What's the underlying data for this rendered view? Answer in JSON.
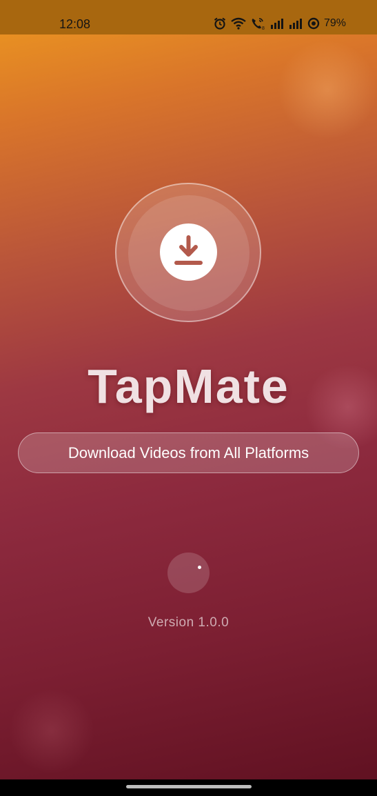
{
  "status_bar": {
    "time": "12:08",
    "battery": "79%",
    "icons": [
      "alarm-icon",
      "wifi-icon",
      "volte-call-icon",
      "signal-icon",
      "signal-icon",
      "battery-saver-icon"
    ]
  },
  "app": {
    "title": "TapMate",
    "tagline": "Download Videos from All Platforms",
    "version": "Version 1.0.0",
    "logo_icon": "download-icon"
  },
  "colors": {
    "gradient_top": "#ee9a1f",
    "gradient_mid": "#9d3842",
    "gradient_bottom": "#5e1020",
    "status_bar": "#a8670f",
    "logo_disc": "#ffffff",
    "logo_glyph": "#b35a4c"
  }
}
